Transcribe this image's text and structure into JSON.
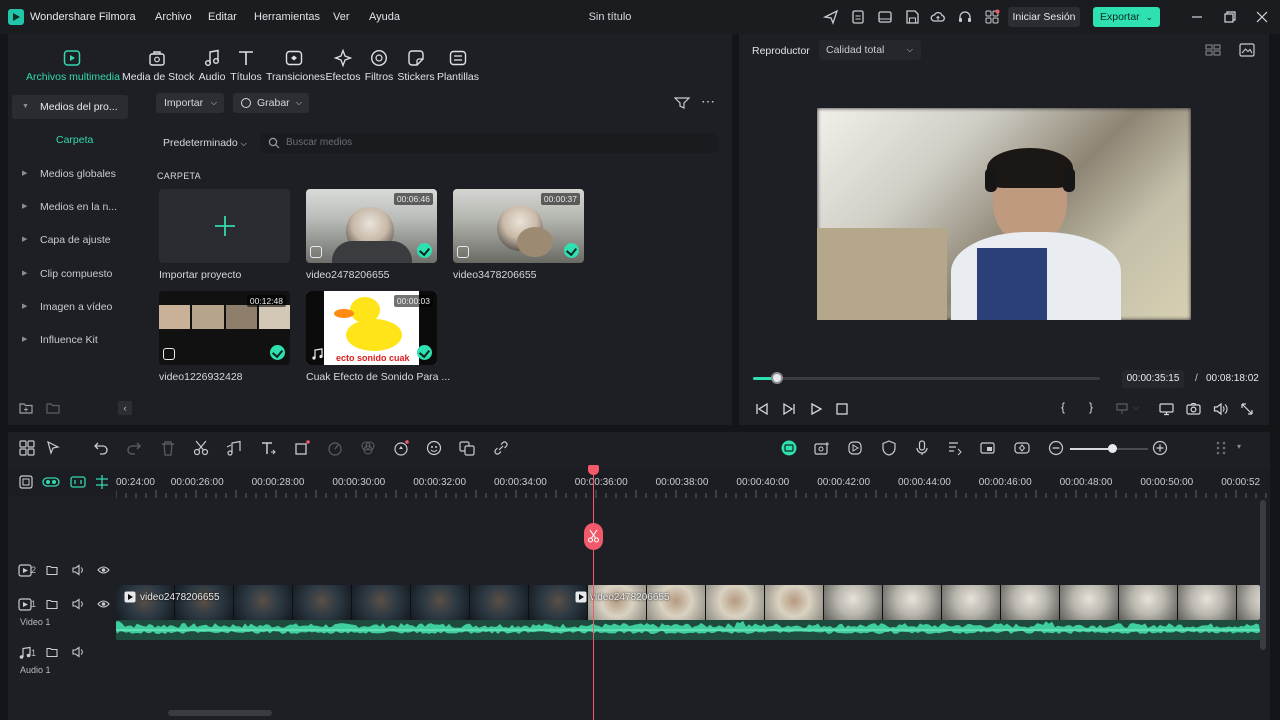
{
  "app": {
    "name": "Wondershare Filmora",
    "document_title": "Sin título",
    "menu": [
      "Archivo",
      "Editar",
      "Herramientas",
      "Ver",
      "Ayuda"
    ],
    "login_label": "Iniciar Sesión",
    "export_label": "Exportar",
    "accent": "#2fe0b0"
  },
  "tabs": [
    {
      "label": "Archivos multimedia",
      "icon": "media-icon",
      "active": true
    },
    {
      "label": "Media de Stock",
      "icon": "stock-icon"
    },
    {
      "label": "Audio",
      "icon": "music-note-icon"
    },
    {
      "label": "Títulos",
      "icon": "text-icon"
    },
    {
      "label": "Transiciones",
      "icon": "transition-icon"
    },
    {
      "label": "Efectos",
      "icon": "effects-icon"
    },
    {
      "label": "Filtros",
      "icon": "filter-icon"
    },
    {
      "label": "Stickers",
      "icon": "sticker-icon"
    },
    {
      "label": "Plantillas",
      "icon": "template-icon"
    }
  ],
  "sidebar": {
    "items": [
      {
        "label": "Medios del pro..."
      },
      {
        "label": "Medios globales"
      },
      {
        "label": "Medios en la n..."
      },
      {
        "label": "Capa de ajuste"
      },
      {
        "label": "Clip compuesto"
      },
      {
        "label": "Imagen a vídeo"
      },
      {
        "label": "Influence Kit"
      }
    ],
    "folder_label": "Carpeta"
  },
  "media": {
    "import_label": "Importar",
    "record_label": "Grabar",
    "sort_label": "Predeterminado",
    "search_placeholder": "Buscar medios",
    "section_label": "CARPETA",
    "items": [
      {
        "name": "Importar proyecto"
      },
      {
        "name": "video2478206655",
        "duration": "00:06:46"
      },
      {
        "name": "video3478206655",
        "duration": "00:00:37"
      },
      {
        "name": "video1226932428",
        "duration": "00:12:48"
      },
      {
        "name": "Cuak Efecto de Sonido Para ...",
        "duration": "00:00:03",
        "overlay_text": "ecto sonido cuak"
      }
    ]
  },
  "player": {
    "label": "Reproductor",
    "quality": "Calidad total",
    "current_time": "00:00:35:15",
    "separator": "/",
    "total_time": "00:08:18:02",
    "progress": 0.07
  },
  "timeline": {
    "ruler": [
      "00:24:00",
      "00:00:26:00",
      "00:00:28:00",
      "00:00:30:00",
      "00:00:32:00",
      "00:00:34:00",
      "00:00:36:00",
      "00:00:38:00",
      "00:00:40:00",
      "00:00:42:00",
      "00:00:44:00",
      "00:00:46:00",
      "00:00:48:00",
      "00:00:50:00",
      "00:00:52"
    ],
    "tracks": [
      {
        "num": "2",
        "label": ""
      },
      {
        "num": "1",
        "label": "Video 1"
      },
      {
        "num": "1",
        "label": "Audio 1"
      }
    ],
    "clips": [
      {
        "title": "video2478206655"
      },
      {
        "title": "video2478206655"
      }
    ]
  }
}
